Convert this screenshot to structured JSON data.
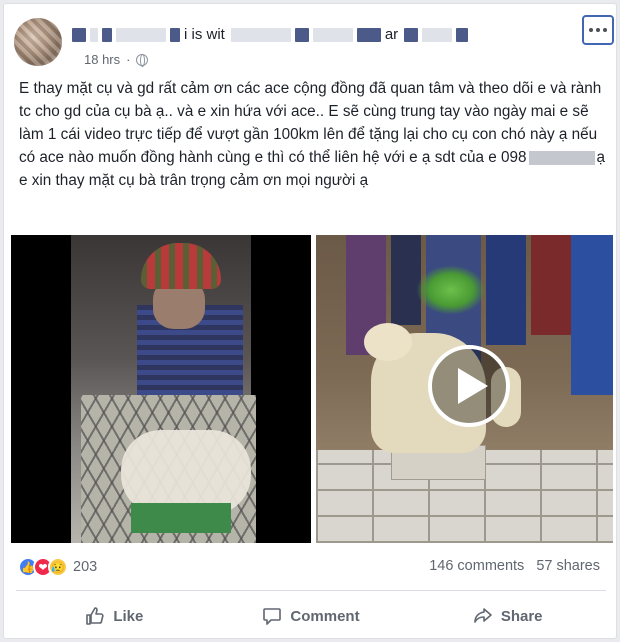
{
  "post": {
    "author_suffix": "i is wit",
    "author_tail": "ar",
    "time": "18 hrs",
    "time_sep": "·",
    "text_part1": "E thay mặt cụ và gd rất cảm ơn các ace cộng đồng đã quan tâm và theo dõi e và rành tc cho gd của cụ bà ạ.. và e xin hứa với ace.. E sẽ cùng trung tay vào ngày mai e sẽ làm 1 cái video trực tiếp để vượt gần 100km lên để tặng lại cho cụ con chó này ạ nếu có ace nào muốn đồng hành cùng e thì có thể liên hệ với e ạ sdt của e 098",
    "text_part2": "ạ e xin thay mặt cụ bà trân trọng cảm ơn mọi người ạ"
  },
  "stats": {
    "reaction_count": "203",
    "comments": "146 comments",
    "shares": "57 shares"
  },
  "reactions": {
    "like": "👍",
    "love": "❤",
    "sad": "😥"
  },
  "actions": {
    "like": "Like",
    "comment": "Comment",
    "share": "Share"
  },
  "colors": {
    "brand": "#4267b2",
    "like_blue": "#3f7ef5",
    "love_red": "#f0284a",
    "sad_yellow": "#f7c945"
  },
  "icons": {
    "more": "more-options-icon",
    "globe": "globe-icon",
    "play": "play-icon",
    "like": "thumbs-up-icon",
    "comment": "comment-icon",
    "share": "share-icon"
  }
}
